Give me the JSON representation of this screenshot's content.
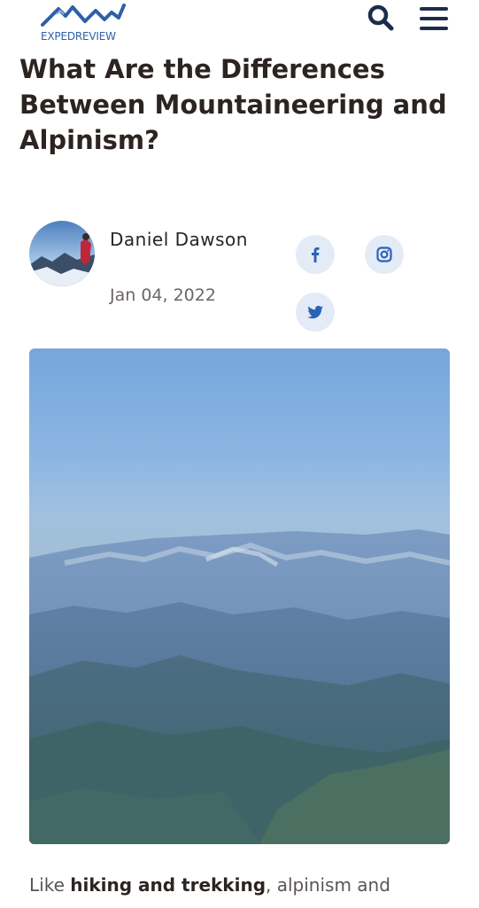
{
  "header": {
    "logo_text": "EXPEDREVIEW",
    "logo_icon": "mountains-logo-icon",
    "search_icon": "search-icon",
    "menu_icon": "hamburger-menu-icon"
  },
  "article": {
    "title": "What Are the Differences Between Mountaineering and Alpinism?",
    "author": {
      "name": "Daniel Dawson",
      "avatar": "author-avatar-photo"
    },
    "date": "Jan 04, 2022",
    "intro": {
      "before_link": "Like ",
      "link_text": "hiking and trekking",
      "after_link": ", alpinism and"
    }
  },
  "share": [
    {
      "name": "facebook",
      "icon": "facebook-icon"
    },
    {
      "name": "instagram",
      "icon": "instagram-icon"
    },
    {
      "name": "twitter",
      "icon": "twitter-icon"
    }
  ],
  "colors": {
    "brand_blue": "#2f5fa8",
    "menu_navy": "#1c2c4c",
    "title_text": "#2b2421",
    "share_bg": "#e3ebf7",
    "share_icon": "#2b63b4"
  }
}
